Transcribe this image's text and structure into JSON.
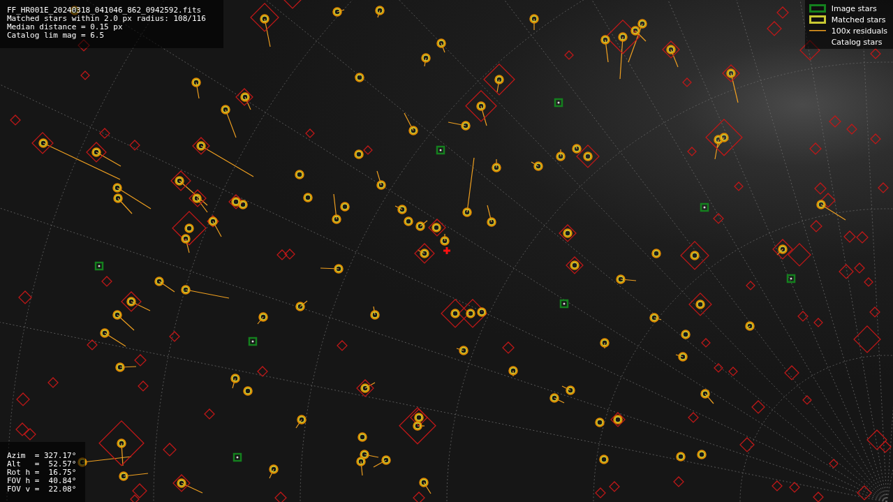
{
  "info_panel": {
    "lines": [
      "FF_HR001E_20240318_041046_862_0942592.fits",
      "Matched stars within 2.0 px radius: 108/116",
      "Median distance = 0.15 px",
      "Catalog lim mag = 6.5"
    ]
  },
  "legend": [
    {
      "kind": "image",
      "label": "Image stars"
    },
    {
      "kind": "matched",
      "label": "Matched stars"
    },
    {
      "kind": "residual",
      "label": "100x residuals"
    },
    {
      "kind": "catalog",
      "label": "Catalog stars"
    }
  ],
  "pointing_panel": {
    "lines": [
      "Azim  = 327.17°",
      "Alt   =  52.57°",
      "Rot h =  16.75°",
      "FOV h =  40.84°",
      "FOV v =  22.08°"
    ]
  }
}
